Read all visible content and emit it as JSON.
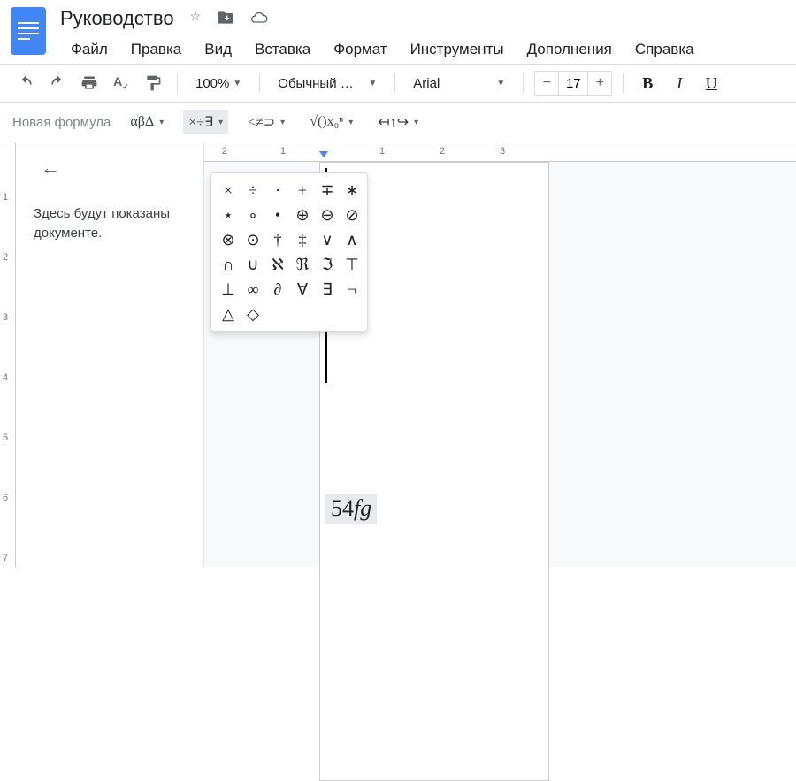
{
  "doc_title": "Руководство",
  "menubar": [
    "Файл",
    "Правка",
    "Вид",
    "Вставка",
    "Формат",
    "Инструменты",
    "Дополнения",
    "Справка"
  ],
  "toolbar": {
    "zoom": "100%",
    "style": "Обычный …",
    "font": "Arial",
    "font_size": "17"
  },
  "eq_toolbar": {
    "label": "Новая формула",
    "groups": [
      "αβΔ",
      "×÷∃",
      "≤≠⊃",
      "√()x₀ⁿ",
      "↤↑↪"
    ]
  },
  "outline": {
    "text": "Здесь будут показаны документе."
  },
  "h_ruler_numbers": [
    "2",
    "1",
    "1",
    "2",
    "3"
  ],
  "v_ruler_numbers": [
    "1",
    "2",
    "3",
    "4",
    "5",
    "6",
    "7"
  ],
  "symbol_popup": {
    "rows": [
      [
        "×",
        "÷",
        "·",
        "±",
        "∓",
        "∗"
      ],
      [
        "⋆",
        "∘",
        "•",
        "⊕",
        "⊖",
        "⊘"
      ],
      [
        "⊗",
        "⊙",
        "†",
        "‡",
        "∨",
        "∧"
      ],
      [
        "∩",
        "∪",
        "ℵ",
        "ℜ",
        "ℑ",
        "⊤"
      ],
      [
        "⊥",
        "∞",
        "∂",
        "∀",
        "∃",
        "¬"
      ]
    ],
    "last_row": [
      "△",
      "◇"
    ]
  },
  "formula_in_doc": {
    "num": "54",
    "vars": "fg"
  }
}
